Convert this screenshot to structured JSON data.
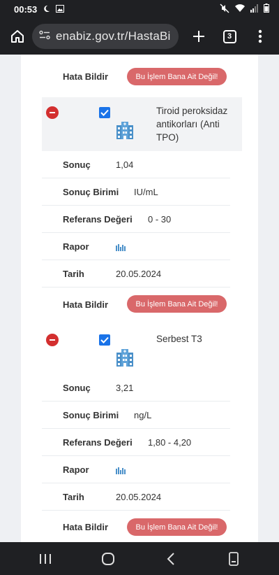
{
  "status_bar": {
    "time": "00:53"
  },
  "browser": {
    "url": "enabiz.gov.tr/HastaBi",
    "tab_count": "3"
  },
  "labels": {
    "sonuc": "Sonuç",
    "birim": "Sonuç Birimi",
    "referans": "Referans Değeri",
    "rapor": "Rapor",
    "tarih": "Tarih",
    "hata": "Hata Bildir",
    "hata_button": "Bu İşlem Bana Ait Değil!"
  },
  "tests": [
    {
      "name": "Tiroid peroksidaz antikorları (Anti TPO)",
      "name_lines": [
        "Tiroid peroksidaz",
        "antikorları (Anti",
        "TPO)"
      ],
      "sonuc": "1,04",
      "birim": "IU/mL",
      "referans": "0 - 30",
      "tarih": "20.05.2024"
    },
    {
      "name": "Serbest T3",
      "name_lines": [
        "Serbest T3"
      ],
      "sonuc": "3,21",
      "birim": "ng/L",
      "referans": "1,80 - 4,20",
      "tarih": "20.05.2024"
    }
  ],
  "colors": {
    "accent": "#1a73e8",
    "danger": "#d32f2f",
    "error_button": "#d9686a",
    "icon_blue": "#4a90c9"
  }
}
